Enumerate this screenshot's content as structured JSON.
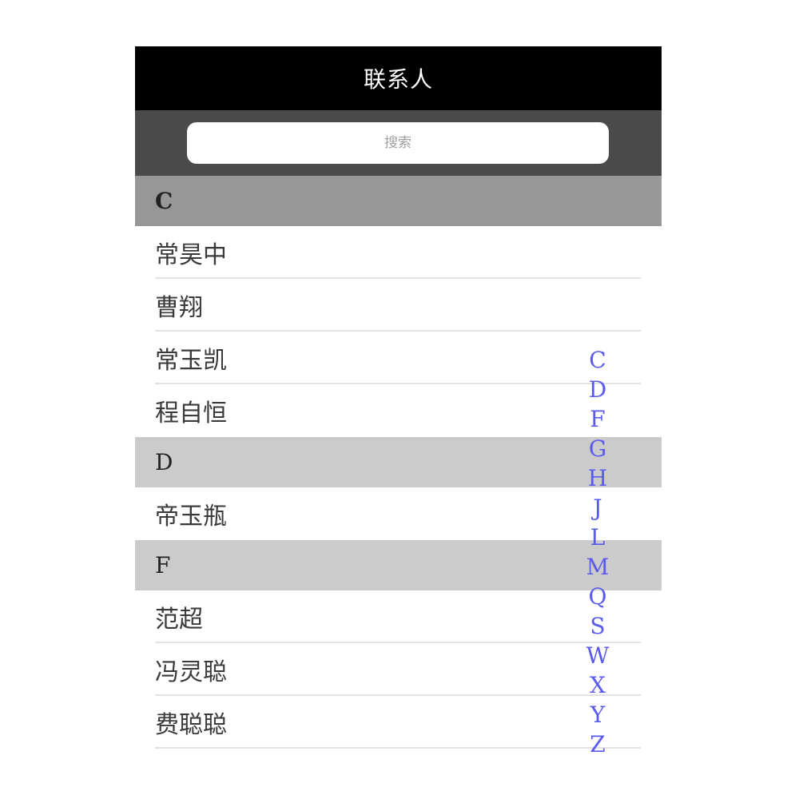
{
  "header": {
    "title": "联系人"
  },
  "search": {
    "placeholder": "搜索"
  },
  "sections": [
    {
      "letter": "C",
      "contacts": [
        "常昊中",
        "曹翔",
        "常玉凯",
        "程自恒"
      ]
    },
    {
      "letter": "D",
      "contacts": [
        "帝玉瓶"
      ]
    },
    {
      "letter": "F",
      "contacts": [
        "范超",
        "冯灵聪",
        "费聪聪"
      ]
    }
  ],
  "index_letters": [
    "C",
    "D",
    "F",
    "G",
    "H",
    "J",
    "L",
    "M",
    "Q",
    "S",
    "W",
    "X",
    "Y",
    "Z"
  ],
  "colors": {
    "navbar": "#000000",
    "searchbar": "#4a4a4a",
    "section_active": "#979797",
    "section": "#cbcbcb",
    "index_letter": "#5a5aee"
  }
}
